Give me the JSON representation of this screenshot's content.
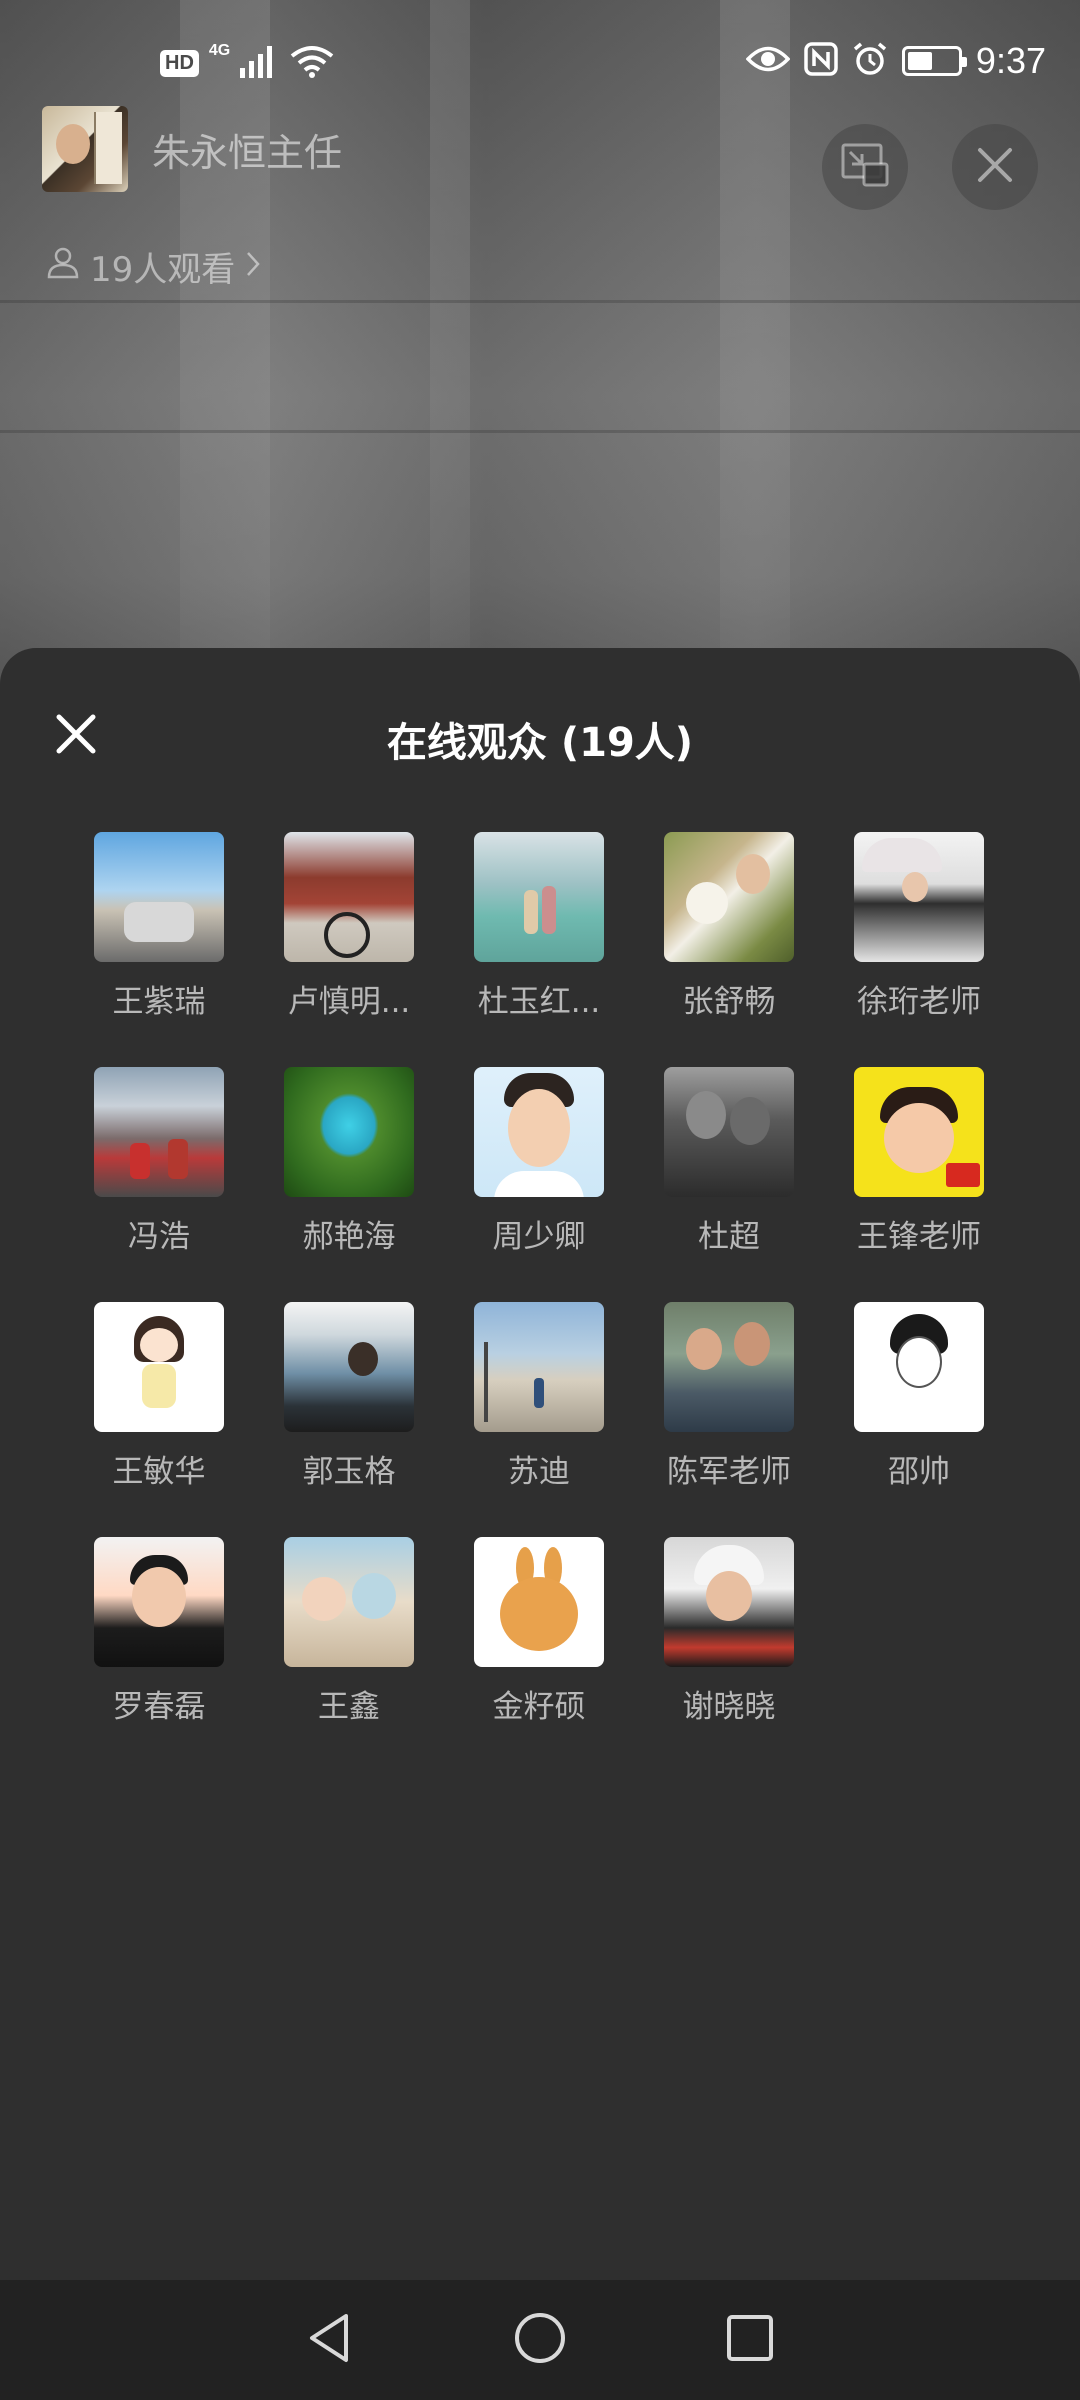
{
  "status_bar": {
    "hd_badge": "HD",
    "network": "4G",
    "time": "9:37",
    "battery_level": 0.5,
    "icons": [
      "signal-icon",
      "wifi-icon",
      "eye-icon",
      "nfc-icon",
      "alarm-icon",
      "battery-icon"
    ]
  },
  "live": {
    "host_name": "朱永恒主任",
    "viewers_text": "19人观看",
    "icons": [
      "user-outline-icon",
      "chevron-right-icon",
      "minimize-window-icon",
      "close-icon"
    ]
  },
  "audience_panel": {
    "title": "在线观众 (19人)",
    "close_icon": "close-icon",
    "members": [
      {
        "name": "王紫瑞"
      },
      {
        "name": "卢慎明..."
      },
      {
        "name": "杜玉红..."
      },
      {
        "name": "张舒畅"
      },
      {
        "name": "徐珩老师"
      },
      {
        "name": "冯浩"
      },
      {
        "name": "郝艳海"
      },
      {
        "name": "周少卿"
      },
      {
        "name": "杜超"
      },
      {
        "name": "王锋老师"
      },
      {
        "name": "王敏华"
      },
      {
        "name": "郭玉格"
      },
      {
        "name": "苏迪"
      },
      {
        "name": "陈军老师"
      },
      {
        "name": "邵帅"
      },
      {
        "name": "罗春磊"
      },
      {
        "name": "王鑫"
      },
      {
        "name": "金籽硕"
      },
      {
        "name": "谢晓晓"
      }
    ]
  },
  "nav_bar": {
    "icons": [
      "back-triangle-icon",
      "home-circle-icon",
      "recents-square-icon"
    ]
  }
}
